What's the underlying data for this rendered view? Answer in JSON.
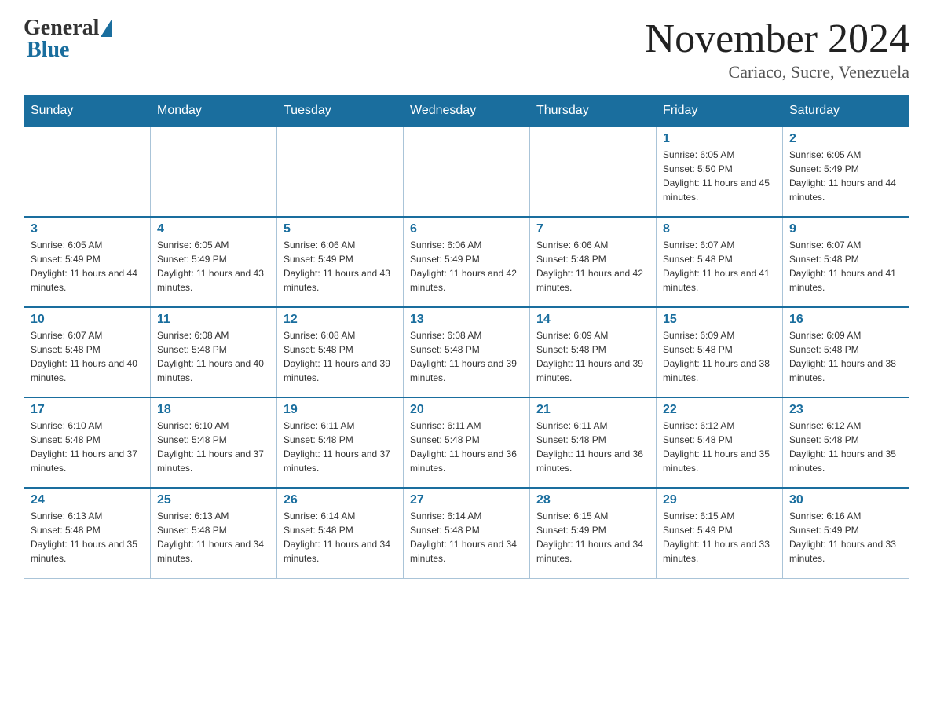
{
  "header": {
    "logo_general": "General",
    "logo_blue": "Blue",
    "month_title": "November 2024",
    "location": "Cariaco, Sucre, Venezuela"
  },
  "days_of_week": [
    "Sunday",
    "Monday",
    "Tuesday",
    "Wednesday",
    "Thursday",
    "Friday",
    "Saturday"
  ],
  "weeks": [
    [
      {
        "day": "",
        "info": ""
      },
      {
        "day": "",
        "info": ""
      },
      {
        "day": "",
        "info": ""
      },
      {
        "day": "",
        "info": ""
      },
      {
        "day": "",
        "info": ""
      },
      {
        "day": "1",
        "info": "Sunrise: 6:05 AM\nSunset: 5:50 PM\nDaylight: 11 hours and 45 minutes."
      },
      {
        "day": "2",
        "info": "Sunrise: 6:05 AM\nSunset: 5:49 PM\nDaylight: 11 hours and 44 minutes."
      }
    ],
    [
      {
        "day": "3",
        "info": "Sunrise: 6:05 AM\nSunset: 5:49 PM\nDaylight: 11 hours and 44 minutes."
      },
      {
        "day": "4",
        "info": "Sunrise: 6:05 AM\nSunset: 5:49 PM\nDaylight: 11 hours and 43 minutes."
      },
      {
        "day": "5",
        "info": "Sunrise: 6:06 AM\nSunset: 5:49 PM\nDaylight: 11 hours and 43 minutes."
      },
      {
        "day": "6",
        "info": "Sunrise: 6:06 AM\nSunset: 5:49 PM\nDaylight: 11 hours and 42 minutes."
      },
      {
        "day": "7",
        "info": "Sunrise: 6:06 AM\nSunset: 5:48 PM\nDaylight: 11 hours and 42 minutes."
      },
      {
        "day": "8",
        "info": "Sunrise: 6:07 AM\nSunset: 5:48 PM\nDaylight: 11 hours and 41 minutes."
      },
      {
        "day": "9",
        "info": "Sunrise: 6:07 AM\nSunset: 5:48 PM\nDaylight: 11 hours and 41 minutes."
      }
    ],
    [
      {
        "day": "10",
        "info": "Sunrise: 6:07 AM\nSunset: 5:48 PM\nDaylight: 11 hours and 40 minutes."
      },
      {
        "day": "11",
        "info": "Sunrise: 6:08 AM\nSunset: 5:48 PM\nDaylight: 11 hours and 40 minutes."
      },
      {
        "day": "12",
        "info": "Sunrise: 6:08 AM\nSunset: 5:48 PM\nDaylight: 11 hours and 39 minutes."
      },
      {
        "day": "13",
        "info": "Sunrise: 6:08 AM\nSunset: 5:48 PM\nDaylight: 11 hours and 39 minutes."
      },
      {
        "day": "14",
        "info": "Sunrise: 6:09 AM\nSunset: 5:48 PM\nDaylight: 11 hours and 39 minutes."
      },
      {
        "day": "15",
        "info": "Sunrise: 6:09 AM\nSunset: 5:48 PM\nDaylight: 11 hours and 38 minutes."
      },
      {
        "day": "16",
        "info": "Sunrise: 6:09 AM\nSunset: 5:48 PM\nDaylight: 11 hours and 38 minutes."
      }
    ],
    [
      {
        "day": "17",
        "info": "Sunrise: 6:10 AM\nSunset: 5:48 PM\nDaylight: 11 hours and 37 minutes."
      },
      {
        "day": "18",
        "info": "Sunrise: 6:10 AM\nSunset: 5:48 PM\nDaylight: 11 hours and 37 minutes."
      },
      {
        "day": "19",
        "info": "Sunrise: 6:11 AM\nSunset: 5:48 PM\nDaylight: 11 hours and 37 minutes."
      },
      {
        "day": "20",
        "info": "Sunrise: 6:11 AM\nSunset: 5:48 PM\nDaylight: 11 hours and 36 minutes."
      },
      {
        "day": "21",
        "info": "Sunrise: 6:11 AM\nSunset: 5:48 PM\nDaylight: 11 hours and 36 minutes."
      },
      {
        "day": "22",
        "info": "Sunrise: 6:12 AM\nSunset: 5:48 PM\nDaylight: 11 hours and 35 minutes."
      },
      {
        "day": "23",
        "info": "Sunrise: 6:12 AM\nSunset: 5:48 PM\nDaylight: 11 hours and 35 minutes."
      }
    ],
    [
      {
        "day": "24",
        "info": "Sunrise: 6:13 AM\nSunset: 5:48 PM\nDaylight: 11 hours and 35 minutes."
      },
      {
        "day": "25",
        "info": "Sunrise: 6:13 AM\nSunset: 5:48 PM\nDaylight: 11 hours and 34 minutes."
      },
      {
        "day": "26",
        "info": "Sunrise: 6:14 AM\nSunset: 5:48 PM\nDaylight: 11 hours and 34 minutes."
      },
      {
        "day": "27",
        "info": "Sunrise: 6:14 AM\nSunset: 5:48 PM\nDaylight: 11 hours and 34 minutes."
      },
      {
        "day": "28",
        "info": "Sunrise: 6:15 AM\nSunset: 5:49 PM\nDaylight: 11 hours and 34 minutes."
      },
      {
        "day": "29",
        "info": "Sunrise: 6:15 AM\nSunset: 5:49 PM\nDaylight: 11 hours and 33 minutes."
      },
      {
        "day": "30",
        "info": "Sunrise: 6:16 AM\nSunset: 5:49 PM\nDaylight: 11 hours and 33 minutes."
      }
    ]
  ]
}
